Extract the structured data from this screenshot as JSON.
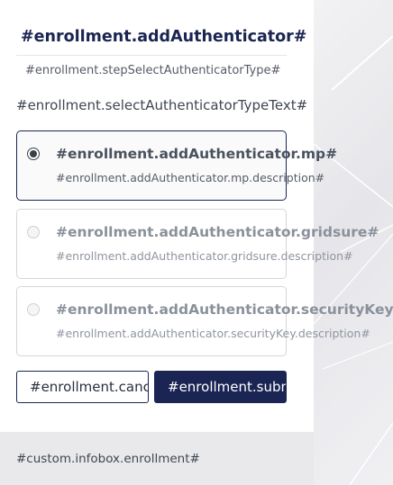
{
  "header": {
    "title": "#enrollment.addAuthenticator#",
    "step": "#enrollment.stepSelectAuthenticatorType#",
    "select_text": "#enrollment.selectAuthenticatorTypeText#"
  },
  "options": [
    {
      "title": "#enrollment.addAuthenticator.mp#",
      "description": "#enrollment.addAuthenticator.mp.description#",
      "selected": true,
      "disabled": false
    },
    {
      "title": "#enrollment.addAuthenticator.gridsure#",
      "description": "#enrollment.addAuthenticator.gridsure.description#",
      "selected": false,
      "disabled": true
    },
    {
      "title": "#enrollment.addAuthenticator.securityKey#",
      "description": "#enrollment.addAuthenticator.securityKey.description#",
      "selected": false,
      "disabled": true
    }
  ],
  "buttons": {
    "cancel_label": "#enrollment.cancel#",
    "submit_label": "#enrollment.submit#"
  },
  "footer": {
    "infobox_text": "#custom.infobox.enrollment#"
  },
  "colors": {
    "primary": "#1b2554",
    "footer_bg": "#e9e9ec"
  }
}
